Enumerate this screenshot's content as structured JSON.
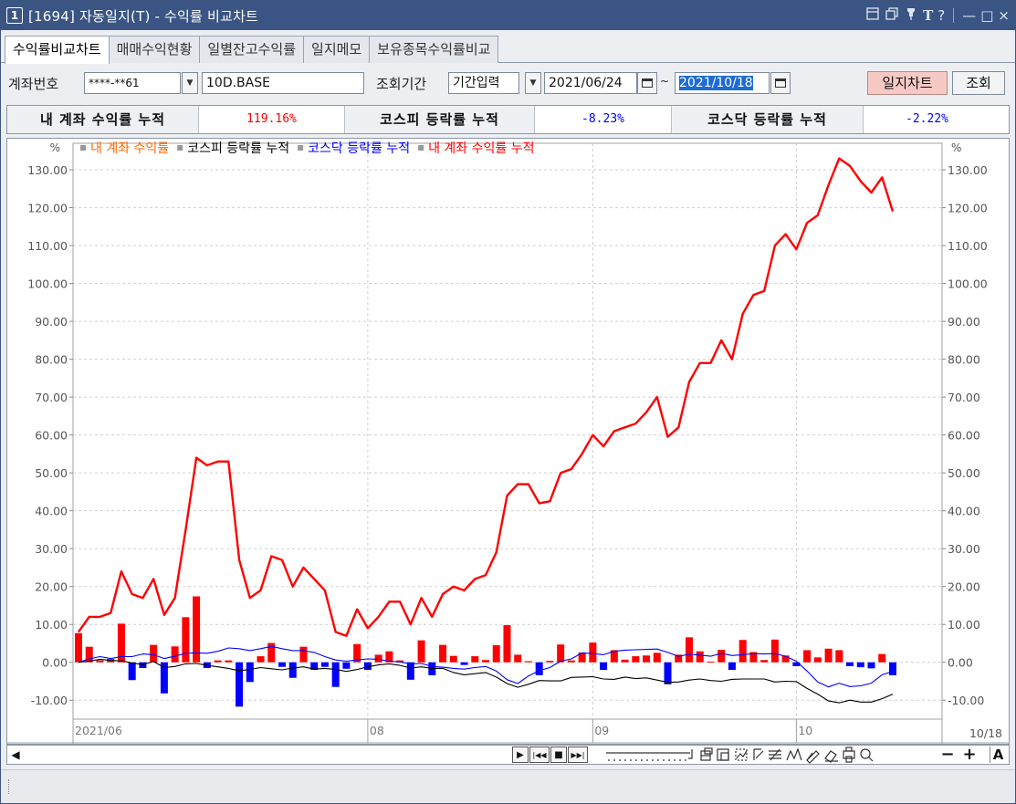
{
  "window": {
    "number": "1",
    "title": "[1694] 자동일지(T) - 수익률 비교차트",
    "icons": [
      "window-icon",
      "copy-window-icon",
      "pin-icon",
      "font-icon",
      "help-icon",
      "minimize-icon",
      "maximize-icon",
      "close-icon"
    ],
    "icon_glyphs": {
      "font": "T",
      "help": "?",
      "minimize": "—",
      "maximize": "□",
      "close": "×"
    }
  },
  "tabs": [
    {
      "label": "수익률비교차트",
      "active": true
    },
    {
      "label": "매매수익현황",
      "active": false
    },
    {
      "label": "일별잔고수익률",
      "active": false
    },
    {
      "label": "일지메모",
      "active": false
    },
    {
      "label": "보유종목수익률비교",
      "active": false
    }
  ],
  "query": {
    "account_label": "계좌번호",
    "account_value": "****-**61",
    "account_name": "10D.BASE",
    "period_label": "조회기간",
    "period_mode": "기간입력",
    "date_from": "2021/06/24",
    "date_sep": "~",
    "date_to": "2021/10/18",
    "journal_chart_button": "일지차트",
    "search_button": "조회"
  },
  "summary": {
    "my_label": "내 계좌 수익률 누적",
    "my_value": "119.16%",
    "kospi_label": "코스피 등락률 누적",
    "kospi_value": "-8.23%",
    "kosdaq_label": "코스닥 등락률 누적",
    "kosdaq_value": "-2.22%"
  },
  "colors": {
    "my_return": "#ff0000",
    "my_return_label": "#ff6600",
    "kospi": "#000000",
    "kosdaq": "#0000ff",
    "bar_pos": "#ff0000",
    "bar_neg": "#0000ff"
  },
  "chart_data": {
    "type": "line",
    "legend": [
      {
        "name": "내 계좌 수익률",
        "color": "#ff6600"
      },
      {
        "name": "코스피 등락률 누적",
        "color": "#000000"
      },
      {
        "name": "코스닥 등락률 누적",
        "color": "#0000ff"
      },
      {
        "name": "내 계좌 수익률 누적",
        "color": "#ff0000"
      }
    ],
    "unit": "%",
    "ylim": [
      -15,
      137
    ],
    "yticks": [
      "130.00",
      "120.00",
      "110.00",
      "100.00",
      "90.00",
      "80.00",
      "70.00",
      "60.00",
      "50.00",
      "40.00",
      "30.00",
      "20.00",
      "10.00",
      "0.00",
      "-10.00"
    ],
    "ytick_values": [
      130,
      120,
      110,
      100,
      90,
      80,
      70,
      60,
      50,
      40,
      30,
      20,
      10,
      0,
      -10
    ],
    "grid": true,
    "x_labels": [
      {
        "label": "2021/06",
        "index": 0
      },
      {
        "label": "08",
        "index": 27
      },
      {
        "label": "09",
        "index": 48
      },
      {
        "label": "10",
        "index": 67
      }
    ],
    "x_end_label": "10/18",
    "n_points": 77,
    "series": [
      {
        "name": "내 계좌 수익률 누적",
        "kind": "line",
        "values": [
          8,
          12,
          12,
          13,
          24,
          18,
          17,
          22,
          12.5,
          17,
          35,
          54,
          52,
          53,
          53,
          27,
          17,
          19,
          28,
          27,
          20,
          25,
          22,
          19,
          8,
          7,
          14,
          9,
          12,
          16,
          16,
          10,
          17,
          12,
          18,
          20,
          19,
          22,
          23,
          29,
          44,
          47,
          47,
          42,
          42.5,
          50,
          51,
          55,
          60,
          57,
          61,
          62,
          63,
          66,
          70,
          59.5,
          62,
          74,
          79,
          79,
          85,
          80,
          92,
          97,
          98,
          110,
          113,
          109,
          116,
          118,
          126,
          133,
          131,
          127,
          124,
          128,
          119
        ]
      },
      {
        "name": "내 계좌 수익률",
        "kind": "bar",
        "values": [
          7.7,
          4.1,
          0.5,
          0.9,
          10.2,
          -4.7,
          -1.5,
          4.6,
          -8.2,
          4.2,
          11.9,
          17.4,
          -1.5,
          0.5,
          0.5,
          -11.7,
          -5.2,
          1.6,
          5.1,
          -1.2,
          -4.1,
          4.1,
          -2.0,
          -1.2,
          -6.5,
          -1.7,
          4.8,
          -2.0,
          2.0,
          2.9,
          0.5,
          -4.6,
          5.8,
          -3.4,
          4.6,
          1.7,
          -0.7,
          1.6,
          0.6,
          4.5,
          9.8,
          2.0,
          0.3,
          -3.4,
          0.4,
          4.7,
          0.5,
          2.6,
          5.2,
          -2.0,
          3.2,
          0.7,
          1.6,
          1.8,
          2.5,
          -5.8,
          2.0,
          6.6,
          2.9,
          0.2,
          3.3,
          -2.0,
          5.9,
          2.7,
          0.6,
          6.0,
          1.8,
          -1.0,
          3.2,
          1.3,
          3.6,
          3.2,
          -1.0,
          -1.3,
          -1.6,
          2.2,
          -3.4
        ]
      },
      {
        "name": "코스피 등락률 누적",
        "kind": "line",
        "values": [
          0,
          0.3,
          0.8,
          0.5,
          0.4,
          -0.2,
          -0.6,
          0.2,
          -1.4,
          -1.1,
          -0.4,
          -0.3,
          -0.8,
          -1.2,
          -1.6,
          -2.2,
          -1.9,
          -1.4,
          -1.7,
          -2.0,
          -1.5,
          -1.2,
          -1.8,
          -1.6,
          -1.9,
          -2.4,
          -1.9,
          -1.2,
          -0.7,
          -0.4,
          -0.8,
          -1.5,
          -1.2,
          -1.6,
          -1.6,
          -2.7,
          -3.3,
          -3.0,
          -2.7,
          -3.9,
          -5.6,
          -6.6,
          -5.8,
          -4.8,
          -4.9,
          -4.9,
          -4.0,
          -3.9,
          -3.8,
          -4.4,
          -4.5,
          -3.9,
          -4.3,
          -4.1,
          -4.7,
          -5.3,
          -5.2,
          -4.7,
          -4.4,
          -4.8,
          -5.0,
          -4.5,
          -4.4,
          -4.4,
          -4.4,
          -5.2,
          -5.0,
          -5.1,
          -6.9,
          -8.4,
          -10.2,
          -10.7,
          -10.0,
          -10.5,
          -10.5,
          -9.6,
          -8.4
        ]
      },
      {
        "name": "코스닥 등락률 누적",
        "kind": "line",
        "values": [
          0,
          0.9,
          1.5,
          1.0,
          1.5,
          1.5,
          2.2,
          2.0,
          1.0,
          1.6,
          2.4,
          2.5,
          2.4,
          2.9,
          3.8,
          3.6,
          3.1,
          3.6,
          4.2,
          3.6,
          3.1,
          3.1,
          2.6,
          1.5,
          0.6,
          0.3,
          0.6,
          0.9,
          0.8,
          0.3,
          0.1,
          -0.4,
          -0.3,
          -1.1,
          -1.3,
          -1.6,
          -1.8,
          -1.4,
          -1.1,
          -2.3,
          -4.6,
          -5.6,
          -3.6,
          -2.2,
          -1.4,
          0.3,
          0.9,
          2.5,
          2.3,
          2.0,
          2.9,
          3.2,
          3.3,
          3.4,
          3.5,
          2.6,
          1.6,
          2.1,
          1.9,
          1.6,
          2.4,
          1.8,
          2.0,
          2.3,
          2.2,
          2.3,
          1.6,
          0.3,
          -2.3,
          -5.2,
          -6.5,
          -5.5,
          -6.4,
          -6.2,
          -5.5,
          -3.3,
          -2.4
        ]
      }
    ]
  },
  "toolbar": {
    "play_glyph": "▶",
    "first_glyph": "|◀◀",
    "stop_glyph": "■",
    "last_glyph": "▶▶|",
    "zoom_out": "−",
    "zoom_in": "+",
    "text_tool": "A",
    "magnifier": "Q"
  }
}
